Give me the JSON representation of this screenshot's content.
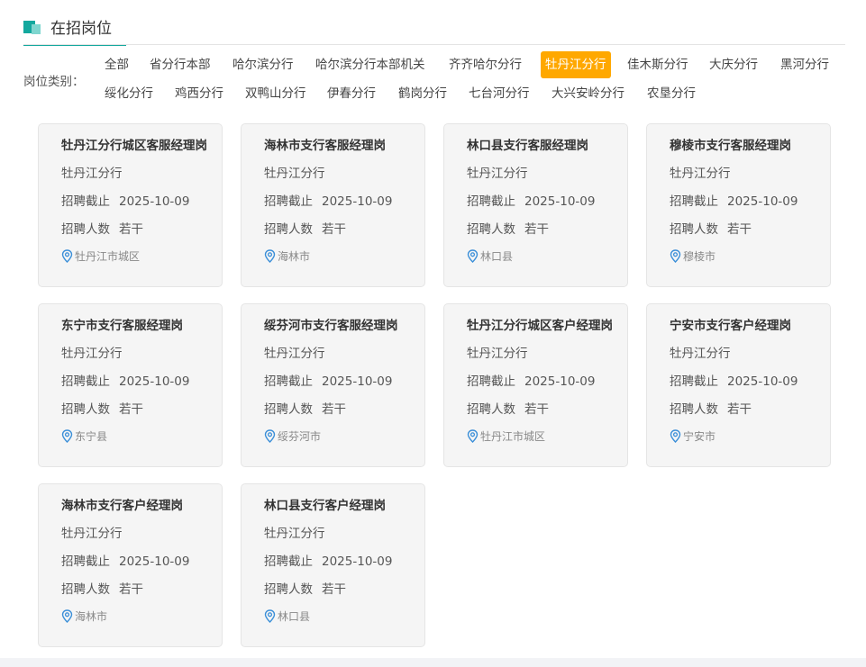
{
  "section": {
    "title": "在招岗位"
  },
  "filter": {
    "label": "岗位类别：",
    "items": [
      "全部",
      "省分行本部",
      "哈尔滨分行",
      "哈尔滨分行本部机关",
      "齐齐哈尔分行",
      "牡丹江分行",
      "佳木斯分行",
      "大庆分行",
      "黑河分行",
      "绥化分行",
      "鸡西分行",
      "双鸭山分行",
      "伊春分行",
      "鹤岗分行",
      "七台河分行",
      "大兴安岭分行",
      "农垦分行"
    ],
    "active": "牡丹江分行"
  },
  "labels": {
    "deadline": "招聘截止",
    "count": "招聘人数"
  },
  "jobs": [
    {
      "title": "牡丹江分行城区客服经理岗",
      "branch": "牡丹江分行",
      "deadline": "2025-10-09",
      "count": "若干",
      "location": "牡丹江市城区"
    },
    {
      "title": "海林市支行客服经理岗",
      "branch": "牡丹江分行",
      "deadline": "2025-10-09",
      "count": "若干",
      "location": "海林市"
    },
    {
      "title": "林口县支行客服经理岗",
      "branch": "牡丹江分行",
      "deadline": "2025-10-09",
      "count": "若干",
      "location": "林口县"
    },
    {
      "title": "穆棱市支行客服经理岗",
      "branch": "牡丹江分行",
      "deadline": "2025-10-09",
      "count": "若干",
      "location": "穆棱市"
    },
    {
      "title": "东宁市支行客服经理岗",
      "branch": "牡丹江分行",
      "deadline": "2025-10-09",
      "count": "若干",
      "location": "东宁县"
    },
    {
      "title": "绥芬河市支行客服经理岗",
      "branch": "牡丹江分行",
      "deadline": "2025-10-09",
      "count": "若干",
      "location": "绥芬河市"
    },
    {
      "title": "牡丹江分行城区客户经理岗",
      "branch": "牡丹江分行",
      "deadline": "2025-10-09",
      "count": "若干",
      "location": "牡丹江市城区"
    },
    {
      "title": "宁安市支行客户经理岗",
      "branch": "牡丹江分行",
      "deadline": "2025-10-09",
      "count": "若干",
      "location": "宁安市"
    },
    {
      "title": "海林市支行客户经理岗",
      "branch": "牡丹江分行",
      "deadline": "2025-10-09",
      "count": "若干",
      "location": "海林市"
    },
    {
      "title": "林口县支行客户经理岗",
      "branch": "牡丹江分行",
      "deadline": "2025-10-09",
      "count": "若干",
      "location": "林口县"
    }
  ],
  "colors": {
    "accent": "#13a89e",
    "active_filter": "#ffa800",
    "location_icon": "#3b8fd8"
  },
  "icons": {
    "location": "map-pin-icon"
  }
}
